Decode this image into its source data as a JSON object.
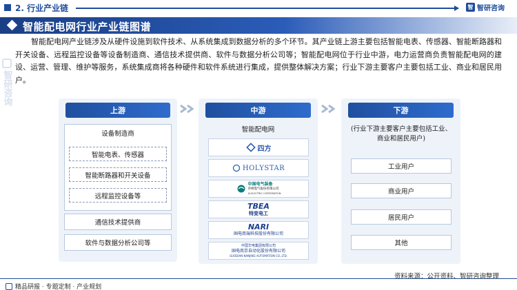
{
  "watermark": {
    "text": "智研咨询"
  },
  "section": {
    "title": "2. 行业产业链"
  },
  "brand": {
    "name": "智研咨询",
    "logo_letter": "智"
  },
  "banner": {
    "title": "智能配电网行业产业链图谱"
  },
  "intro": {
    "text": "智能配电网产业链涉及从硬件设施到软件技术、从系统集成到数据分析的多个环节。其产业链上游主要包括智能电表、传感器、智能断路器和开关设备、远程监控设备等设备制造商、通信技术提供商、软件与数据分析公司等；智能配电网位于行业中游，电力运营商负责智能配电网的建设、运营、管理、维护等服务，系统集成商将各种硬件和软件系统进行集成，提供整体解决方案；行业下游主要客户主要包括工业、商业和居民用户。"
  },
  "upstream": {
    "title": "上游",
    "group_title": "设备制造商",
    "group_items": [
      "智能电表、传感器",
      "智能断路器和开关设备",
      "远程监控设备等"
    ],
    "items": [
      "通信技术提供商",
      "软件与数据分析公司等"
    ]
  },
  "midstream": {
    "title": "中游",
    "label": "智能配电网",
    "companies": [
      {
        "name": "四方",
        "icon": "sifang-logo-icon",
        "color": "#2a5bb0"
      },
      {
        "name": "HOLYSTAR",
        "icon": "holystar-logo-icon",
        "color": "#2d5fa8"
      },
      {
        "name": "中国电气装备",
        "sub": "许继电气股份有限公司",
        "sub2": "XJ ELECTRIC CORPORATION",
        "icon": "xj-electric-logo-icon",
        "color": "#0a7d7a"
      },
      {
        "name": "TBEA",
        "sub": "特变电工",
        "icon": "tbea-logo-icon",
        "color": "#1b3f8f"
      },
      {
        "name": "NARI",
        "sub": "国电南瑞科技股份有限公司",
        "icon": "nari-logo-icon",
        "color": "#1b3f8f"
      },
      {
        "name": "中国华电集团有限公司",
        "sub": "国电南京自动化股份有限公司",
        "sub2": "GUODIAN NANJING AUTOMATION CO.,LTD.",
        "icon": "sac-logo-icon",
        "color": "#1b3f8f"
      }
    ]
  },
  "downstream": {
    "title": "下游",
    "note": "(行业下游主要客户主要包括工业、商业和居民用户)",
    "items": [
      "工业用户",
      "商业用户",
      "居民用户",
      "其他"
    ]
  },
  "footer": {
    "left": "精品研报 · 专题定制 · 产业规划",
    "source": "资料来源：公开资料、智研咨询整理"
  }
}
